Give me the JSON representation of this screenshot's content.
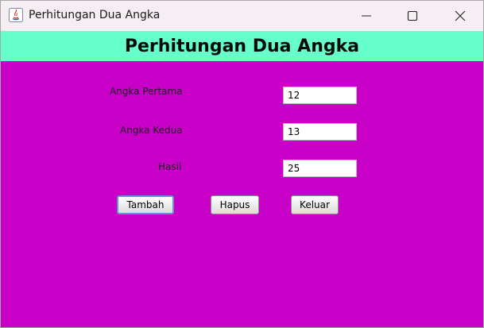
{
  "window": {
    "title": "Perhitungan Dua Angka",
    "controls": {
      "minimize_icon": "minimize-icon",
      "maximize_icon": "maximize-icon",
      "close_icon": "close-icon"
    }
  },
  "header": {
    "title": "Perhitungan Dua Angka"
  },
  "form": {
    "first_label": "Angka Pertama",
    "first_value": "12",
    "second_label": "Angka Kedua",
    "second_value": "13",
    "result_label": "Hasil",
    "result_value": "25"
  },
  "buttons": {
    "add_label": "Tambah",
    "clear_label": "Hapus",
    "exit_label": "Keluar"
  },
  "colors": {
    "content_background": "#c800c8",
    "header_background": "#66ffcc",
    "titlebar_background": "#f5eef3"
  }
}
